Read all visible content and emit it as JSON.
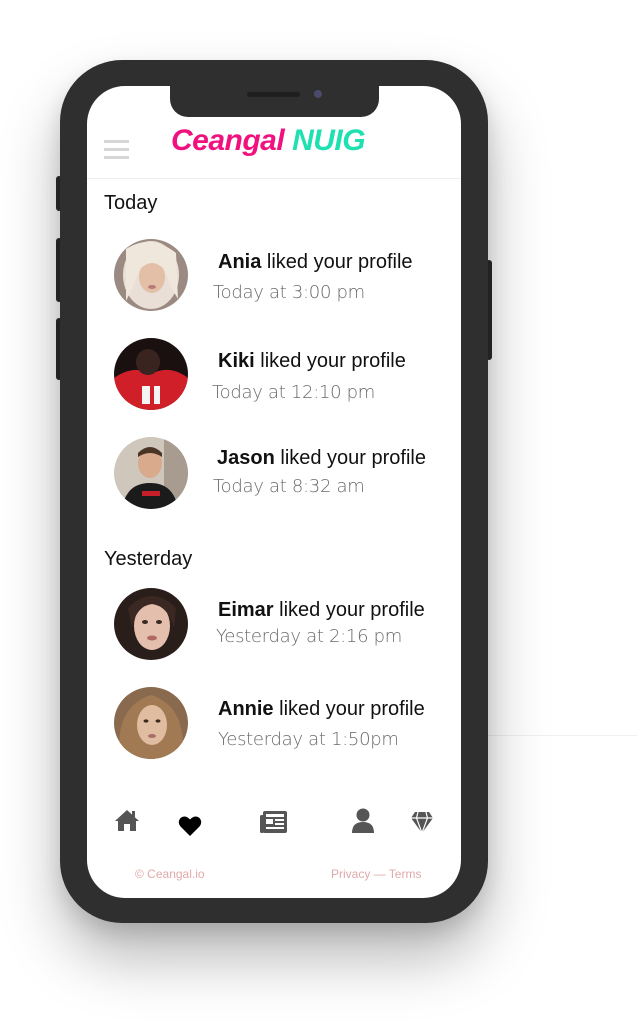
{
  "app": {
    "logo_part1": "Ceangal",
    "logo_part2": "NUIG"
  },
  "sections": {
    "today": "Today",
    "yesterday": "Yesterday"
  },
  "notifications": [
    {
      "name": "Ania",
      "action": " liked your profile",
      "time": "Today at 3:00 pm"
    },
    {
      "name": "Kiki",
      "action": " liked your profile",
      "time": "Today at 12:10 pm"
    },
    {
      "name": "Jason",
      "action": " liked your profile",
      "time": "Today at 8:32 am"
    },
    {
      "name": "Eimar",
      "action": " liked your profile",
      "time": "Yesterday at 2:16 pm"
    },
    {
      "name": "Annie",
      "action": " liked your profile",
      "time": "Yesterday at 1:50pm"
    }
  ],
  "nav": {
    "icons": [
      "home-icon",
      "heart-icon",
      "news-icon",
      "profile-icon",
      "diamond-icon"
    ],
    "active": "heart-icon"
  },
  "footer": {
    "copyright": "© Ceangal.io",
    "links": "Privacy — Terms"
  },
  "colors": {
    "brand_pink": "#f0117f",
    "brand_teal": "#1ee0b0",
    "phone_frame": "#2f2f2f",
    "footer_text": "#e0a9a9"
  }
}
